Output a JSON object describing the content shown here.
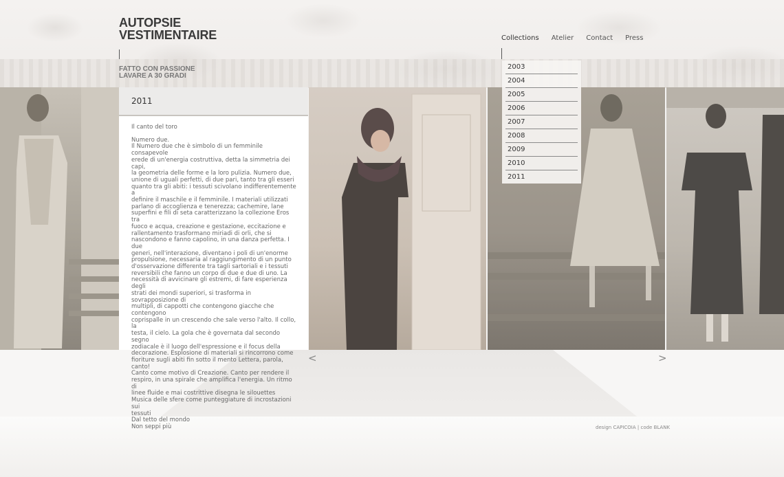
{
  "brand": {
    "line1": "AUTOPSIE",
    "line2": "VESTIMENTAIRE"
  },
  "tagline": {
    "line1": "FATTO CON PASSIONE",
    "line2": "LAVARE A 30 GRADI"
  },
  "nav": {
    "items": [
      {
        "label": "Collections",
        "active": true
      },
      {
        "label": "Atelier"
      },
      {
        "label": "Contact"
      },
      {
        "label": "Press"
      }
    ]
  },
  "collections_menu": [
    "2003",
    "2004",
    "2005",
    "2006",
    "2007",
    "2008",
    "2009",
    "2010",
    "2011"
  ],
  "panel": {
    "year": "2011",
    "title": "Il canto del toro",
    "lines": [
      "Numero due.",
      "Il Numero due che è simbolo di un femminile consapevole",
      "erede di un'energia costruttiva, detta la simmetria dei capi,",
      "la geometria delle forme e la loro pulizia. Numero due,",
      "unione di uguali perfetti, di due pari, tanto tra gli esseri",
      "quanto tra gli abiti: i tessuti scivolano indifferentemente a",
      "definire il maschile e il femminile. I materiali utilizzati",
      "parlano di accoglienza e tenerezza; cachemire, lane",
      "superfini e fili di seta caratterizzano la collezione Eros tra",
      "fuoco e acqua, creazione e gestazione, eccitazione e",
      "rallentamento trasformano miriadi di orli, che si",
      "nascondono e fanno capolino, in una danza perfetta. I due",
      "generi, nell'interazione, diventano i poli di un'enorme",
      "propulsione, necessaria al raggiungimento di un punto",
      "d'osservazione differente tra tagli sartoriali e i tessuti",
      "reversibili che fanno un corpo di due e due di uno. La",
      "necessità di avvicinare gli estremi, di fare esperienza degli",
      "strati dei mondi superiori, si trasforma in sovrapposizione di",
      "multipli, di cappotti che contengono giacche che contengono",
      "coprispalle in un crescendo che sale verso l'alto. Il collo, la",
      "testa, il cielo. La gola che è governata dal secondo segno",
      "zodiacale è il luogo dell'espressione e il focus della",
      "decorazione. Esplosione di materiali si rincorrono come",
      "fioriture sugli abiti fin sotto il mento Lettera, parola, canto!",
      "Canto come motivo di Creazione. Canto per rendere il",
      "respiro, in una spirale che amplifica l'energia. Un ritmo di",
      "linee fluide e mai costrittive disegna le silouettes",
      "Musica delle sfere come punteggiature di incrostazioni sui",
      "tessuti",
      "Dal tetto del mondo",
      "Non seppi più"
    ]
  },
  "arrows": {
    "prev": "<",
    "next": ">"
  },
  "credits": "design CAPICOIA | code BLANK"
}
